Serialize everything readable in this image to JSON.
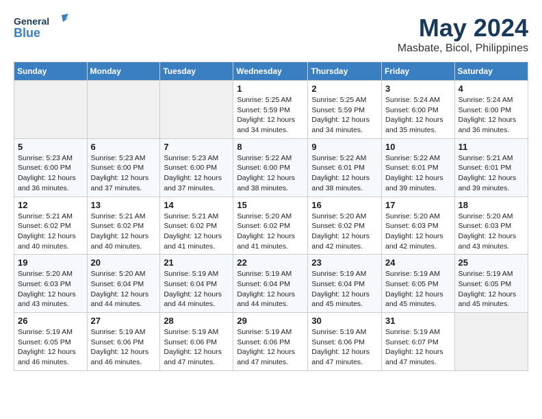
{
  "header": {
    "logo": {
      "general": "General",
      "blue": "Blue"
    },
    "title": "May 2024",
    "location": "Masbate, Bicol, Philippines"
  },
  "weekdays": [
    "Sunday",
    "Monday",
    "Tuesday",
    "Wednesday",
    "Thursday",
    "Friday",
    "Saturday"
  ],
  "weeks": [
    [
      {
        "day": "",
        "info": ""
      },
      {
        "day": "",
        "info": ""
      },
      {
        "day": "",
        "info": ""
      },
      {
        "day": "1",
        "info": "Sunrise: 5:25 AM\nSunset: 5:59 PM\nDaylight: 12 hours\nand 34 minutes."
      },
      {
        "day": "2",
        "info": "Sunrise: 5:25 AM\nSunset: 5:59 PM\nDaylight: 12 hours\nand 34 minutes."
      },
      {
        "day": "3",
        "info": "Sunrise: 5:24 AM\nSunset: 6:00 PM\nDaylight: 12 hours\nand 35 minutes."
      },
      {
        "day": "4",
        "info": "Sunrise: 5:24 AM\nSunset: 6:00 PM\nDaylight: 12 hours\nand 36 minutes."
      }
    ],
    [
      {
        "day": "5",
        "info": "Sunrise: 5:23 AM\nSunset: 6:00 PM\nDaylight: 12 hours\nand 36 minutes."
      },
      {
        "day": "6",
        "info": "Sunrise: 5:23 AM\nSunset: 6:00 PM\nDaylight: 12 hours\nand 37 minutes."
      },
      {
        "day": "7",
        "info": "Sunrise: 5:23 AM\nSunset: 6:00 PM\nDaylight: 12 hours\nand 37 minutes."
      },
      {
        "day": "8",
        "info": "Sunrise: 5:22 AM\nSunset: 6:00 PM\nDaylight: 12 hours\nand 38 minutes."
      },
      {
        "day": "9",
        "info": "Sunrise: 5:22 AM\nSunset: 6:01 PM\nDaylight: 12 hours\nand 38 minutes."
      },
      {
        "day": "10",
        "info": "Sunrise: 5:22 AM\nSunset: 6:01 PM\nDaylight: 12 hours\nand 39 minutes."
      },
      {
        "day": "11",
        "info": "Sunrise: 5:21 AM\nSunset: 6:01 PM\nDaylight: 12 hours\nand 39 minutes."
      }
    ],
    [
      {
        "day": "12",
        "info": "Sunrise: 5:21 AM\nSunset: 6:02 PM\nDaylight: 12 hours\nand 40 minutes."
      },
      {
        "day": "13",
        "info": "Sunrise: 5:21 AM\nSunset: 6:02 PM\nDaylight: 12 hours\nand 40 minutes."
      },
      {
        "day": "14",
        "info": "Sunrise: 5:21 AM\nSunset: 6:02 PM\nDaylight: 12 hours\nand 41 minutes."
      },
      {
        "day": "15",
        "info": "Sunrise: 5:20 AM\nSunset: 6:02 PM\nDaylight: 12 hours\nand 41 minutes."
      },
      {
        "day": "16",
        "info": "Sunrise: 5:20 AM\nSunset: 6:02 PM\nDaylight: 12 hours\nand 42 minutes."
      },
      {
        "day": "17",
        "info": "Sunrise: 5:20 AM\nSunset: 6:03 PM\nDaylight: 12 hours\nand 42 minutes."
      },
      {
        "day": "18",
        "info": "Sunrise: 5:20 AM\nSunset: 6:03 PM\nDaylight: 12 hours\nand 43 minutes."
      }
    ],
    [
      {
        "day": "19",
        "info": "Sunrise: 5:20 AM\nSunset: 6:03 PM\nDaylight: 12 hours\nand 43 minutes."
      },
      {
        "day": "20",
        "info": "Sunrise: 5:20 AM\nSunset: 6:04 PM\nDaylight: 12 hours\nand 44 minutes."
      },
      {
        "day": "21",
        "info": "Sunrise: 5:19 AM\nSunset: 6:04 PM\nDaylight: 12 hours\nand 44 minutes."
      },
      {
        "day": "22",
        "info": "Sunrise: 5:19 AM\nSunset: 6:04 PM\nDaylight: 12 hours\nand 44 minutes."
      },
      {
        "day": "23",
        "info": "Sunrise: 5:19 AM\nSunset: 6:04 PM\nDaylight: 12 hours\nand 45 minutes."
      },
      {
        "day": "24",
        "info": "Sunrise: 5:19 AM\nSunset: 6:05 PM\nDaylight: 12 hours\nand 45 minutes."
      },
      {
        "day": "25",
        "info": "Sunrise: 5:19 AM\nSunset: 6:05 PM\nDaylight: 12 hours\nand 45 minutes."
      }
    ],
    [
      {
        "day": "26",
        "info": "Sunrise: 5:19 AM\nSunset: 6:05 PM\nDaylight: 12 hours\nand 46 minutes."
      },
      {
        "day": "27",
        "info": "Sunrise: 5:19 AM\nSunset: 6:06 PM\nDaylight: 12 hours\nand 46 minutes."
      },
      {
        "day": "28",
        "info": "Sunrise: 5:19 AM\nSunset: 6:06 PM\nDaylight: 12 hours\nand 47 minutes."
      },
      {
        "day": "29",
        "info": "Sunrise: 5:19 AM\nSunset: 6:06 PM\nDaylight: 12 hours\nand 47 minutes."
      },
      {
        "day": "30",
        "info": "Sunrise: 5:19 AM\nSunset: 6:06 PM\nDaylight: 12 hours\nand 47 minutes."
      },
      {
        "day": "31",
        "info": "Sunrise: 5:19 AM\nSunset: 6:07 PM\nDaylight: 12 hours\nand 47 minutes."
      },
      {
        "day": "",
        "info": ""
      }
    ]
  ]
}
